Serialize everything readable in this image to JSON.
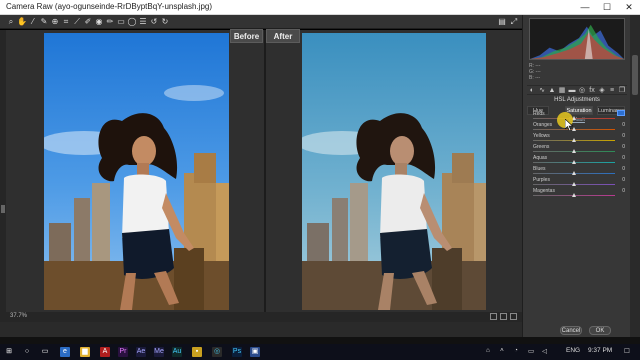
{
  "window": {
    "title": "Camera Raw (ayo-ogunseinde-RrDByptBqY-unsplash.jpg)",
    "minimize_glyph": "—",
    "maximize_glyph": "☐",
    "close_glyph": "✕"
  },
  "toolbar": {
    "tools": [
      "zoom-tool",
      "hand-tool",
      "white-balance-tool",
      "color-sampler-tool",
      "targeted-adjustment-tool",
      "crop-tool",
      "straighten-tool",
      "spot-removal-tool",
      "red-eye-tool",
      "adjustment-brush-tool",
      "graduated-filter-tool",
      "radial-filter-tool",
      "preferences-tool",
      "rotate-left-tool",
      "rotate-right-tool"
    ],
    "right_tools": [
      "filmstrip-toggle",
      "fullscreen-toggle"
    ]
  },
  "views": {
    "before_label": "Before",
    "after_label": "After"
  },
  "status": {
    "zoom": "37.7%"
  },
  "panel": {
    "rgb_readout": [
      "R: ---",
      "G: ---",
      "B: ---"
    ],
    "section_title": "HSL Adjustments",
    "tabs": [
      {
        "label": "Hue",
        "active": false
      },
      {
        "label": "Saturation",
        "active": true
      },
      {
        "label": "Luminance",
        "active": false
      }
    ],
    "default_link": "Default",
    "sliders": [
      {
        "name": "Reds",
        "value": "",
        "color": "#c0392b",
        "position": 0.5,
        "active": true
      },
      {
        "name": "Oranges",
        "value": "0",
        "color": "#d35400",
        "position": 0.5
      },
      {
        "name": "Yellows",
        "value": "0",
        "color": "#c9a500",
        "position": 0.5
      },
      {
        "name": "Greens",
        "value": "0",
        "color": "#2e8b57",
        "position": 0.5
      },
      {
        "name": "Aquas",
        "value": "0",
        "color": "#1aa3a3",
        "position": 0.5
      },
      {
        "name": "Blues",
        "value": "0",
        "color": "#2c6fbf",
        "position": 0.5
      },
      {
        "name": "Purples",
        "value": "0",
        "color": "#7b4fb8",
        "position": 0.5
      },
      {
        "name": "Magentas",
        "value": "0",
        "color": "#b8398f",
        "position": 0.5
      }
    ]
  },
  "buttons": {
    "cancel": "Cancel",
    "ok": "OK"
  },
  "taskbar": {
    "apps": [
      "start-button",
      "search-icon",
      "task-view-icon",
      "edge-icon",
      "file-explorer-icon",
      "pdf-icon",
      "premiere-icon",
      "after-effects-icon",
      "adobe-media-icon",
      "audition-icon",
      "illustrator-icon",
      "chrome-icon",
      "photoshop-icon",
      "photos-icon"
    ],
    "language": "ENG",
    "time": "9:37 PM"
  }
}
